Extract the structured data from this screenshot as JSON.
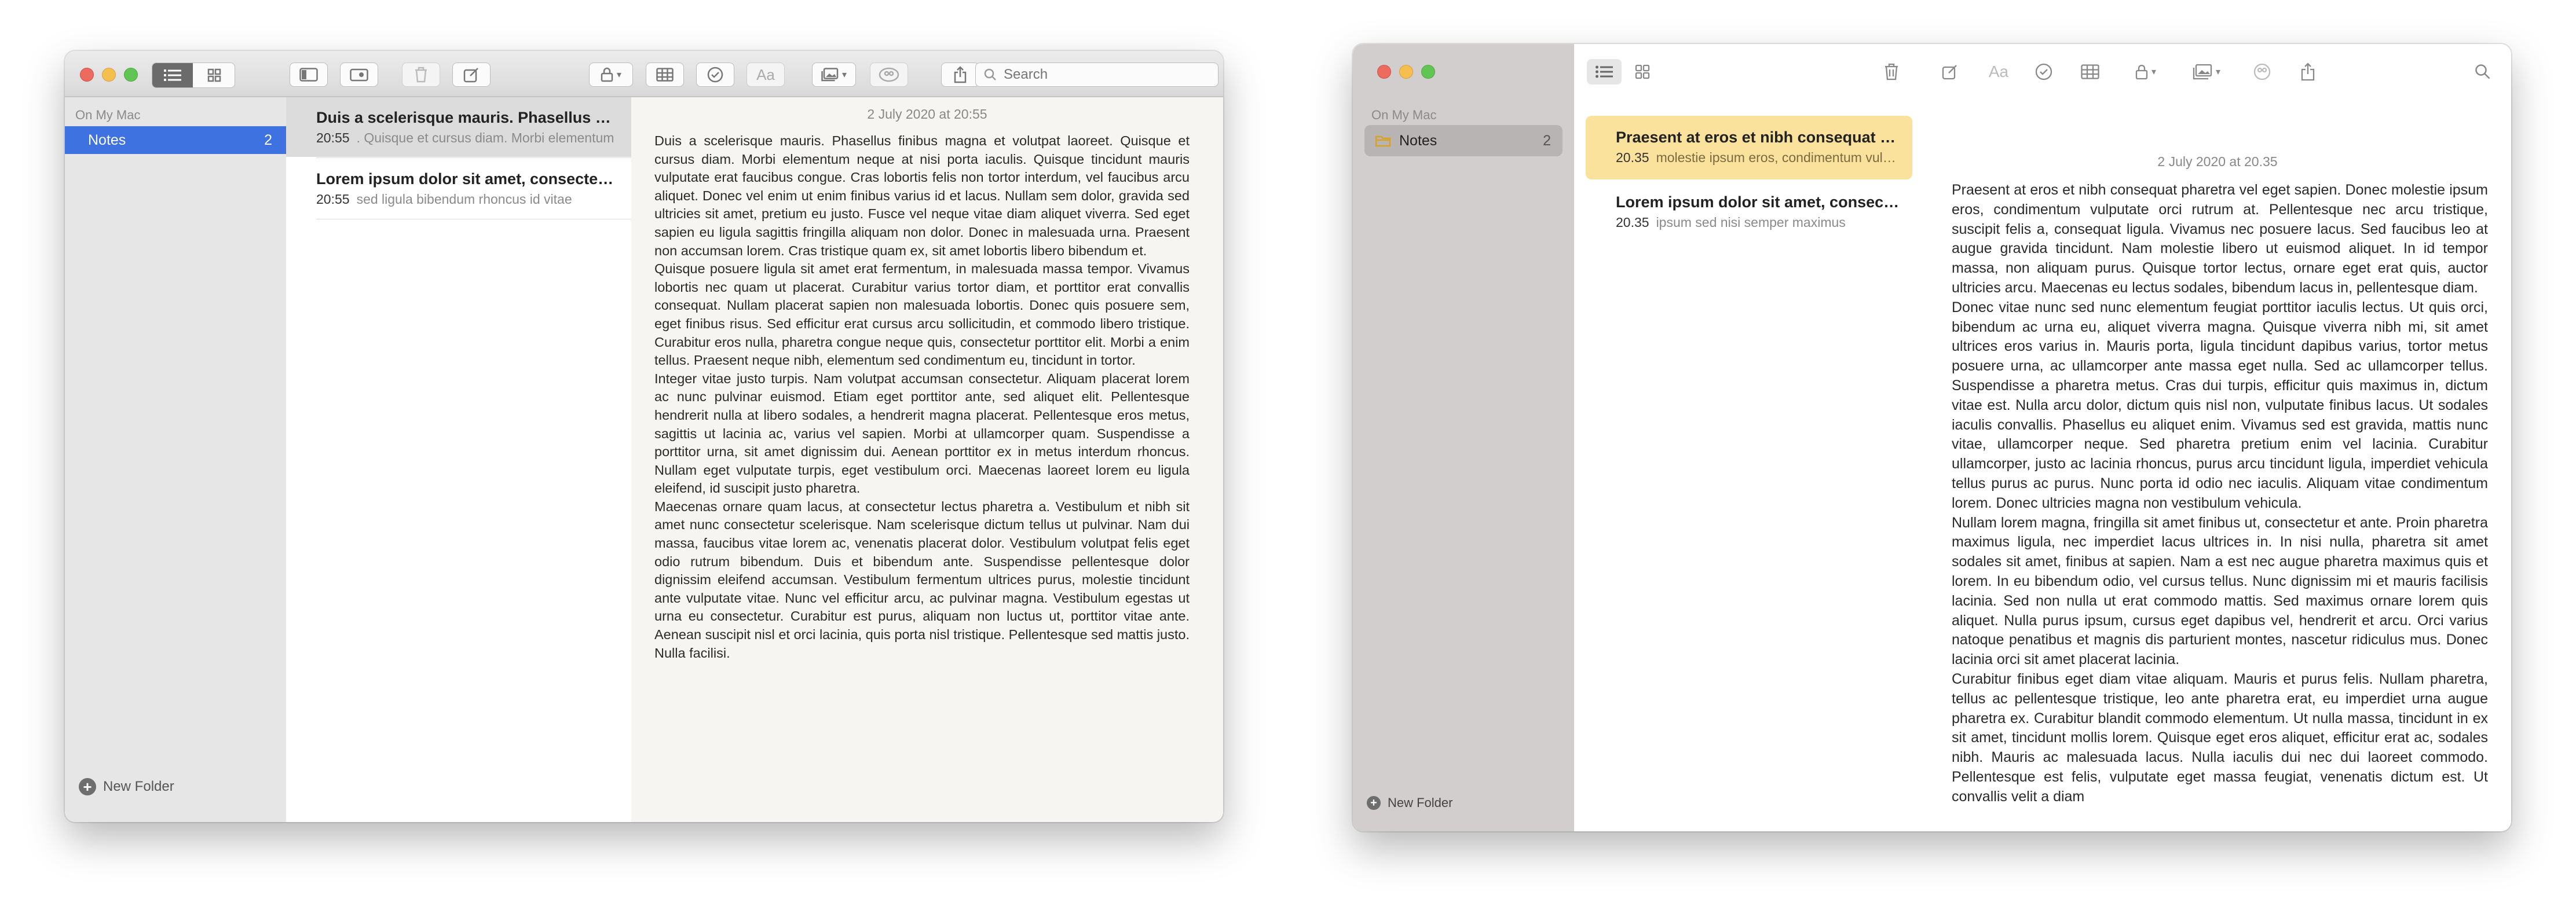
{
  "window1": {
    "search_placeholder": "Search",
    "sidebar": {
      "section": "On My Mac",
      "folder": {
        "name": "Notes",
        "count": "2"
      },
      "new_folder": "New Folder"
    },
    "notes": [
      {
        "title": "Duis a scelerisque mauris. Phasellus finibus magna et volutpat laoreet.",
        "time": "20:55",
        "preview": ". Quisque et cursus diam. Morbi elementum"
      },
      {
        "title": "Lorem ipsum dolor sit amet, consectetur adipiscing elit.",
        "time": "20:55",
        "preview": "sed ligula bibendum rhoncus id vitae"
      }
    ],
    "editor": {
      "date": "2 July 2020 at 20:55",
      "paragraphs": [
        "Duis a scelerisque mauris. Phasellus finibus magna et volutpat laoreet. Quisque et cursus diam. Morbi elementum neque at nisi porta iaculis. Quisque tincidunt mauris vulputate erat faucibus congue. Cras lobortis felis non tortor interdum, vel faucibus arcu aliquet. Donec vel enim ut enim finibus varius id et lacus. Nullam sem dolor, gravida sed ultricies sit amet, pretium eu justo. Fusce vel neque vitae diam aliquet viverra. Sed eget sapien eu ligula sagittis fringilla aliquam non dolor. Donec in malesuada urna. Praesent non accumsan lorem. Cras tristique quam ex, sit amet lobortis libero bibendum et.",
        "Quisque posuere ligula sit amet erat fermentum, in malesuada massa tempor. Vivamus lobortis nec quam ut placerat. Curabitur varius tortor diam, et porttitor erat convallis consequat. Nullam placerat sapien non malesuada lobortis. Donec quis posuere sem, eget finibus risus. Sed efficitur erat cursus arcu sollicitudin, et commodo libero tristique. Curabitur eros nulla, pharetra congue neque quis, consectetur porttitor elit. Morbi a enim tellus. Praesent neque nibh, elementum sed condimentum eu, tincidunt in tortor.",
        "Integer vitae justo turpis. Nam volutpat accumsan consectetur. Aliquam placerat lorem ac nunc pulvinar euismod. Etiam eget porttitor ante, sed aliquet elit. Pellentesque hendrerit nulla at libero sodales, a hendrerit magna placerat. Pellentesque eros metus, sagittis ut lacinia ac, varius vel sapien. Morbi at ullamcorper quam. Suspendisse a porttitor urna, sit amet dignissim dui. Aenean porttitor ex in metus interdum rhoncus. Nullam eget vulputate turpis, eget vestibulum orci. Maecenas laoreet lorem eu ligula eleifend, id suscipit justo pharetra.",
        "Maecenas ornare quam lacus, at consectetur lectus pharetra a. Vestibulum et nibh sit amet nunc consectetur scelerisque. Nam scelerisque dictum tellus ut pulvinar. Nam dui massa, faucibus vitae lorem ac, venenatis placerat dolor. Vestibulum volutpat felis eget odio rutrum bibendum. Duis et bibendum ante. Suspendisse pellentesque dolor dignissim eleifend accumsan. Vestibulum fermentum ultrices purus, molestie tincidunt ante vulputate vitae. Nunc vel efficitur arcu, ac pulvinar magna. Vestibulum egestas ut urna eu consectetur. Curabitur est purus, aliquam non luctus ut, porttitor vitae ante. Aenean suscipit nisl et orci lacinia, quis porta nisl tristique. Pellentesque sed mattis justo. Nulla facilisi."
      ]
    }
  },
  "window2": {
    "sidebar": {
      "section": "On My Mac",
      "folder": {
        "name": "Notes",
        "count": "2"
      },
      "new_folder": "New Folder"
    },
    "notes": [
      {
        "title": "Praesent at eros et nibh consequat pharetra vel eget sapien.",
        "time": "20.35",
        "preview": "molestie ipsum eros, condimentum vulputate"
      },
      {
        "title": "Lorem ipsum dolor sit amet, consectetur adipiscing elit.",
        "time": "20.35",
        "preview": "ipsum sed nisi semper maximus"
      }
    ],
    "editor": {
      "date": "2 July 2020 at 20.35",
      "paragraphs": [
        "Praesent at eros et nibh consequat pharetra vel eget sapien. Donec molestie ipsum eros, condimentum vulputate orci rutrum at. Pellentesque nec arcu tristique, suscipit felis a, consequat ligula. Vivamus nec posuere lacus. Sed faucibus leo at augue gravida tincidunt. Nam molestie libero ut euismod aliquet. In id tempor massa, non aliquam purus. Quisque tortor lectus, ornare eget erat quis, auctor ultricies arcu. Maecenas eu lectus sodales, bibendum lacus in, pellentesque diam.",
        "Donec vitae nunc sed nunc elementum feugiat porttitor iaculis lectus. Ut quis orci, bibendum ac urna eu, aliquet viverra magna. Quisque viverra nibh mi, sit amet ultrices eros varius in. Mauris porta, ligula tincidunt dapibus varius, tortor metus posuere urna, ac ullamcorper ante massa eget nulla. Sed ac ullamcorper tellus. Suspendisse a pharetra metus. Cras dui turpis, efficitur quis maximus in, dictum vitae est. Nulla arcu dolor, dictum quis nisl non, vulputate finibus lacus. Ut sodales iaculis convallis. Phasellus eu aliquet enim. Vivamus sed est gravida, mattis nunc vitae, ullamcorper neque. Sed pharetra pretium enim vel lacinia. Curabitur ullamcorper, justo ac lacinia rhoncus, purus arcu tincidunt ligula, imperdiet vehicula tellus purus ac purus. Nunc porta id odio nec iaculis. Aliquam vitae condimentum lorem. Donec ultricies magna non vestibulum vehicula.",
        "Nullam lorem magna, fringilla sit amet finibus ut, consectetur et ante. Proin pharetra maximus ligula, nec imperdiet lacus ultrices in. In nisi nulla, pharetra sit amet sodales sit amet, finibus at sapien. Nam a est nec augue pharetra maximus quis et lorem. In eu bibendum odio, vel cursus tellus. Nunc dignissim mi et mauris facilisis lacinia. Sed non nulla ut erat commodo mattis. Sed maximus ornare lorem quis aliquet. Nulla purus ipsum, cursus eget dapibus vel, hendrerit et arcu. Orci varius natoque penatibus et magnis dis parturient montes, nascetur ridiculus mus. Donec lacinia orci sit amet placerat lacinia.",
        "Curabitur finibus eget diam vitae aliquam. Mauris et purus felis. Nullam pharetra, tellus ac pellentesque tristique, leo ante pharetra erat, eu imperdiet urna augue pharetra ex. Curabitur blandit commodo elementum. Ut nulla massa, tincidunt in ex sit amet, tincidunt mollis lorem. Quisque eget eros aliquet, efficitur erat ac, sodales nibh. Mauris ac malesuada lacus. Nulla iaculis dui nec dui laoreet commodo. Pellentesque est felis, vulputate eget massa feugiat, venenatis dictum est. Ut convallis velit a diam"
      ]
    }
  }
}
